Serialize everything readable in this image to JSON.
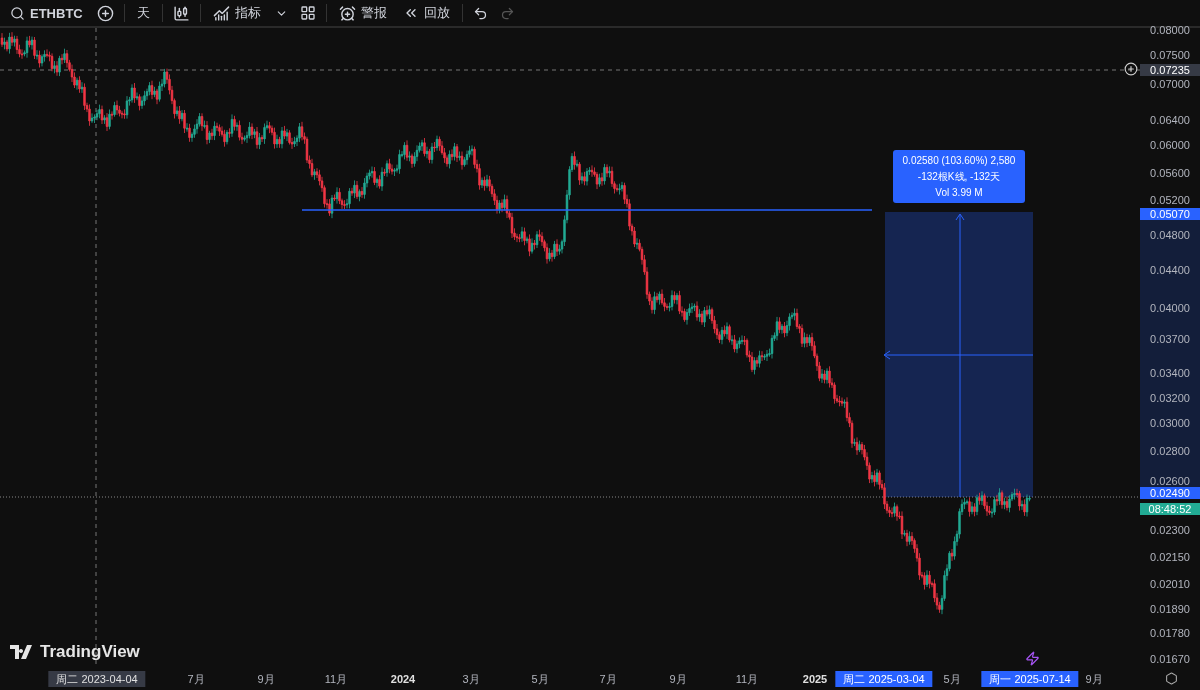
{
  "toolbar": {
    "symbol": "ETHBTC",
    "interval": "天",
    "indicators": "指标",
    "alert": "警报",
    "replay": "回放",
    "redo": {
      "disabled": true
    }
  },
  "measure": {
    "lines": [
      "0.02580 (103.60%) 2,580",
      "-132根K线, -132天",
      "Vol 3.99 M"
    ]
  },
  "price_axis": [
    {
      "text": "0.08000",
      "kind": "tick"
    },
    {
      "text": "0.07500",
      "kind": "tick"
    },
    {
      "text": "0.07235",
      "kind": "crosshair"
    },
    {
      "text": "0.07000",
      "kind": "tick"
    },
    {
      "text": "0.06400",
      "kind": "tick"
    },
    {
      "text": "0.06000",
      "kind": "tick"
    },
    {
      "text": "0.05600",
      "kind": "tick"
    },
    {
      "text": "0.05200",
      "kind": "tick"
    },
    {
      "text": "0.05070",
      "kind": "range"
    },
    {
      "text": "0.04800",
      "kind": "tick"
    },
    {
      "text": "0.04400",
      "kind": "tick"
    },
    {
      "text": "0.04000",
      "kind": "tick"
    },
    {
      "text": "0.03700",
      "kind": "tick"
    },
    {
      "text": "0.03400",
      "kind": "tick"
    },
    {
      "text": "0.03200",
      "kind": "tick"
    },
    {
      "text": "0.03000",
      "kind": "tick"
    },
    {
      "text": "0.02800",
      "kind": "tick"
    },
    {
      "text": "0.02600",
      "kind": "tick"
    },
    {
      "text": "0.02490",
      "kind": "range"
    },
    {
      "text": "08:48:52",
      "kind": "countdown"
    },
    {
      "text": "0.02300",
      "kind": "tick"
    },
    {
      "text": "0.02150",
      "kind": "tick"
    },
    {
      "text": "0.02010",
      "kind": "tick"
    },
    {
      "text": "0.01890",
      "kind": "tick"
    },
    {
      "text": "0.01780",
      "kind": "tick"
    },
    {
      "text": "0.01670",
      "kind": "tick"
    }
  ],
  "time_axis": [
    {
      "text": "周二 2023-04-04",
      "kind": "crosshair"
    },
    {
      "text": "7月",
      "kind": "month"
    },
    {
      "text": "9月",
      "kind": "month"
    },
    {
      "text": "11月",
      "kind": "month"
    },
    {
      "text": "2024",
      "kind": "year"
    },
    {
      "text": "3月",
      "kind": "month"
    },
    {
      "text": "5月",
      "kind": "month"
    },
    {
      "text": "7月",
      "kind": "month"
    },
    {
      "text": "9月",
      "kind": "month"
    },
    {
      "text": "11月",
      "kind": "month"
    },
    {
      "text": "2025",
      "kind": "year"
    },
    {
      "text": "周二 2025-03-04",
      "kind": "range"
    },
    {
      "text": "5月",
      "kind": "month"
    },
    {
      "text": "周一 2025-07-14",
      "kind": "range"
    },
    {
      "text": "9月",
      "kind": "month"
    }
  ],
  "logo": "TradingView"
}
